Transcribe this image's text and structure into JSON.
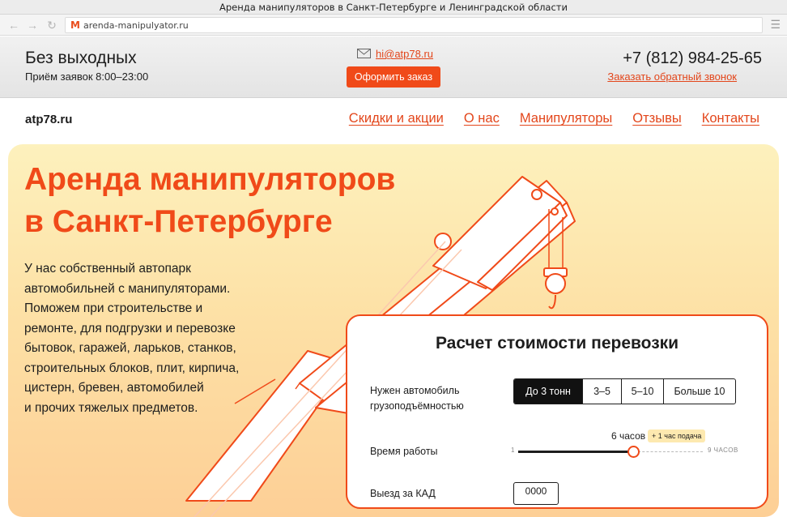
{
  "window": {
    "title": "Аренда манипуляторов в Санкт-Петербурге и Ленинградской области"
  },
  "browser": {
    "url": "arenda-manipulyator.ru",
    "favicon": "M"
  },
  "topbar": {
    "hours_title": "Без выходных",
    "hours_sub": "Приём заявок 8:00–23:00",
    "email": "hi@atp78.ru",
    "order_button": "Оформить заказ",
    "phone": "+7 (812) 984-25-65",
    "callback_link": "Заказать обратный звонок"
  },
  "nav": {
    "logo": "atp78.ru",
    "links": [
      "Скидки и акции",
      "О нас",
      "Манипуляторы",
      "Отзывы",
      "Контакты"
    ]
  },
  "hero": {
    "title_line1": "Аренда манипуляторов",
    "title_line2": "в Санкт-Петербурге",
    "text_lines": [
      "У нас собственный автопарк",
      "автомобильней с манипуляторами.",
      "Поможем при строительстве и",
      "ремонте, для подгрузки и перевозке",
      "бытовок, гаражей, ларьков, станков,",
      "строительных блоков, плит, кирпича,",
      "цистерн, бревен, автомобилей",
      "и прочих тяжелых предметов."
    ]
  },
  "calculator": {
    "title": "Расчет стоимости перевозки",
    "capacity_label_line1": "Нужен автомобиль",
    "capacity_label_line2": "грузоподъёмностью",
    "capacity_options": [
      "До 3 тонн",
      "3–5",
      "5–10",
      "Больше 10"
    ],
    "capacity_selected": "До 3 тонн",
    "time_label": "Время работы",
    "time_value": "6 часов",
    "time_badge": "+ 1 час подача",
    "slider_min": "1",
    "slider_max": "9 ЧАСОВ",
    "slider_value_hours": 6,
    "next_row_label": "Выезд за КАД",
    "next_row_value": "0000"
  },
  "colors": {
    "accent": "#f04a19",
    "link": "#e3461b",
    "text": "#1d1d1d",
    "badge": "#fde9b0"
  }
}
